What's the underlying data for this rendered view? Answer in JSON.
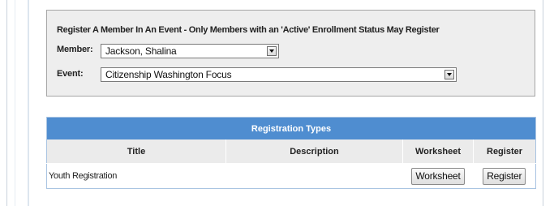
{
  "register_form": {
    "heading": "Register A Member In An Event - Only Members with an 'Active' Enrollment Status May Register",
    "member_label": "Member:",
    "member_value": "Jackson, Shalina",
    "event_label": "Event:",
    "event_value": "Citizenship Washington Focus"
  },
  "registration_types": {
    "caption": "Registration Types",
    "columns": [
      "Title",
      "Description",
      "Worksheet",
      "Register"
    ],
    "rows": [
      {
        "title": "Youth Registration",
        "description": "",
        "worksheet_button": "Worksheet",
        "register_button": "Register"
      }
    ]
  },
  "colors": {
    "table_header_blue": "#4f8dd0",
    "panel_background": "#eeeeee",
    "column_header_gray": "#ebebeb"
  }
}
